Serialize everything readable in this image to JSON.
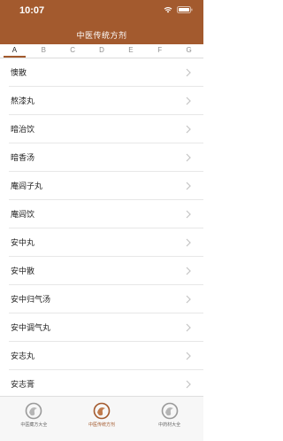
{
  "status": {
    "time": "10:07"
  },
  "header": {
    "title": "中医传统方剂"
  },
  "tabs": [
    {
      "label": "A",
      "active": true
    },
    {
      "label": "B",
      "active": false
    },
    {
      "label": "C",
      "active": false
    },
    {
      "label": "D",
      "active": false
    },
    {
      "label": "E",
      "active": false
    },
    {
      "label": "F",
      "active": false
    },
    {
      "label": "G",
      "active": false
    }
  ],
  "list": [
    {
      "label": "懊散"
    },
    {
      "label": "熬漆丸"
    },
    {
      "label": "暗治饮"
    },
    {
      "label": "暗香汤"
    },
    {
      "label": "庵闾子丸"
    },
    {
      "label": "庵闾饮"
    },
    {
      "label": "安中丸"
    },
    {
      "label": "安中散"
    },
    {
      "label": "安中归气汤"
    },
    {
      "label": "安中调气丸"
    },
    {
      "label": "安志丸"
    },
    {
      "label": "安志膏"
    }
  ],
  "tabbar": [
    {
      "label": "中医藏方大全",
      "icon": "swirl-icon",
      "active": false
    },
    {
      "label": "中医传统方剂",
      "icon": "swirl-icon",
      "active": true
    },
    {
      "label": "中药材大全",
      "icon": "swirl-icon",
      "active": false
    }
  ],
  "colors": {
    "accent": "#a35a2e",
    "divider": "#e7e7e7",
    "chevron": "#c4c4c4"
  }
}
